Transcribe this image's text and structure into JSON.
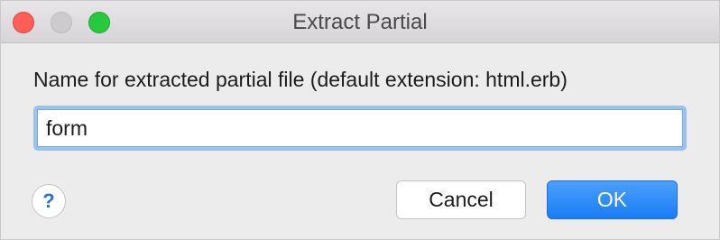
{
  "window": {
    "title": "Extract Partial"
  },
  "dialog": {
    "prompt": "Name for extracted partial file (default extension: html.erb)",
    "input_value": "form",
    "help_glyph": "?",
    "cancel_label": "Cancel",
    "ok_label": "OK"
  },
  "colors": {
    "accent": "#1a7cf5",
    "focus_ring": "#9cc1ec",
    "close": "#fd5f57",
    "maximize": "#27c93f"
  }
}
